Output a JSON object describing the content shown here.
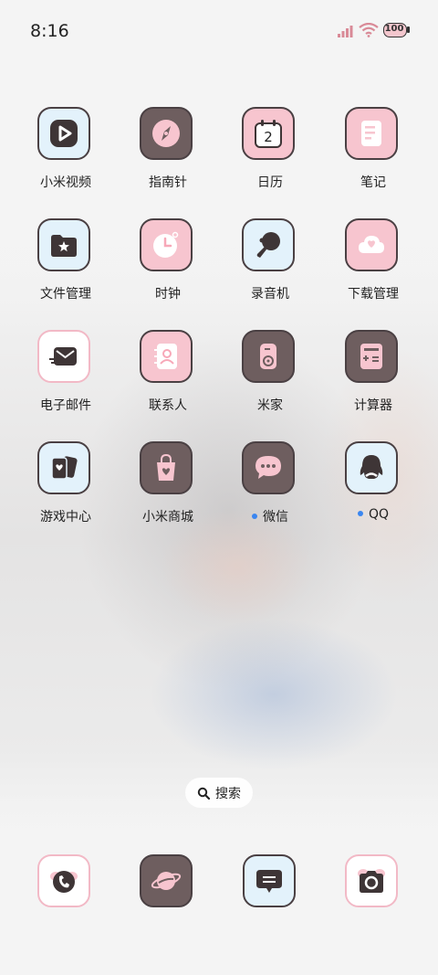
{
  "status_bar": {
    "time": "8:16",
    "battery_level": "100",
    "icons": [
      "signal-icon",
      "wifi-icon",
      "battery-icon"
    ]
  },
  "apps": [
    {
      "label": "小米视频",
      "icon": "play-icon"
    },
    {
      "label": "指南针",
      "icon": "compass-icon"
    },
    {
      "label": "日历",
      "icon": "calendar-icon",
      "day": "2"
    },
    {
      "label": "笔记",
      "icon": "notes-icon"
    },
    {
      "label": "文件管理",
      "icon": "folder-icon"
    },
    {
      "label": "时钟",
      "icon": "clock-icon"
    },
    {
      "label": "录音机",
      "icon": "recorder-icon"
    },
    {
      "label": "下载管理",
      "icon": "download-cloud-icon"
    },
    {
      "label": "电子邮件",
      "icon": "mail-icon"
    },
    {
      "label": "联系人",
      "icon": "contacts-icon"
    },
    {
      "label": "米家",
      "icon": "home-device-icon"
    },
    {
      "label": "计算器",
      "icon": "calculator-icon"
    },
    {
      "label": "游戏中心",
      "icon": "game-cards-icon"
    },
    {
      "label": "小米商城",
      "icon": "shopping-bag-icon"
    },
    {
      "label": "微信",
      "icon": "chat-bubble-icon",
      "new_badge": true
    },
    {
      "label": "QQ",
      "icon": "penguin-icon",
      "new_badge": true
    }
  ],
  "search": {
    "label": "搜索"
  },
  "dock": [
    {
      "icon": "phone-icon"
    },
    {
      "icon": "browser-planet-icon"
    },
    {
      "icon": "message-icon"
    },
    {
      "icon": "camera-icon"
    }
  ],
  "colors": {
    "tile_blue": "#e3f2fb",
    "tile_pink": "#f7c5cf",
    "tile_dark": "#6e5e5f",
    "outline": "#4a4043",
    "badge_dot": "#3a86f0"
  }
}
